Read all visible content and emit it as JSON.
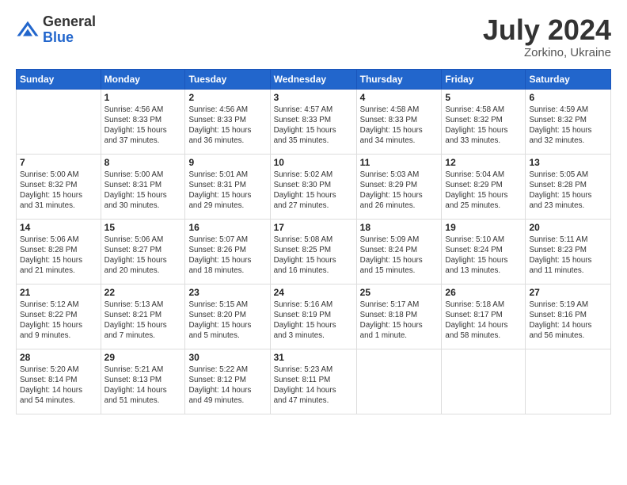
{
  "logo": {
    "general": "General",
    "blue": "Blue"
  },
  "title": {
    "month_year": "July 2024",
    "location": "Zorkino, Ukraine"
  },
  "headers": [
    "Sunday",
    "Monday",
    "Tuesday",
    "Wednesday",
    "Thursday",
    "Friday",
    "Saturday"
  ],
  "weeks": [
    [
      {
        "day": "",
        "info": ""
      },
      {
        "day": "1",
        "info": "Sunrise: 4:56 AM\nSunset: 8:33 PM\nDaylight: 15 hours\nand 37 minutes."
      },
      {
        "day": "2",
        "info": "Sunrise: 4:56 AM\nSunset: 8:33 PM\nDaylight: 15 hours\nand 36 minutes."
      },
      {
        "day": "3",
        "info": "Sunrise: 4:57 AM\nSunset: 8:33 PM\nDaylight: 15 hours\nand 35 minutes."
      },
      {
        "day": "4",
        "info": "Sunrise: 4:58 AM\nSunset: 8:33 PM\nDaylight: 15 hours\nand 34 minutes."
      },
      {
        "day": "5",
        "info": "Sunrise: 4:58 AM\nSunset: 8:32 PM\nDaylight: 15 hours\nand 33 minutes."
      },
      {
        "day": "6",
        "info": "Sunrise: 4:59 AM\nSunset: 8:32 PM\nDaylight: 15 hours\nand 32 minutes."
      }
    ],
    [
      {
        "day": "7",
        "info": "Sunrise: 5:00 AM\nSunset: 8:32 PM\nDaylight: 15 hours\nand 31 minutes."
      },
      {
        "day": "8",
        "info": "Sunrise: 5:00 AM\nSunset: 8:31 PM\nDaylight: 15 hours\nand 30 minutes."
      },
      {
        "day": "9",
        "info": "Sunrise: 5:01 AM\nSunset: 8:31 PM\nDaylight: 15 hours\nand 29 minutes."
      },
      {
        "day": "10",
        "info": "Sunrise: 5:02 AM\nSunset: 8:30 PM\nDaylight: 15 hours\nand 27 minutes."
      },
      {
        "day": "11",
        "info": "Sunrise: 5:03 AM\nSunset: 8:29 PM\nDaylight: 15 hours\nand 26 minutes."
      },
      {
        "day": "12",
        "info": "Sunrise: 5:04 AM\nSunset: 8:29 PM\nDaylight: 15 hours\nand 25 minutes."
      },
      {
        "day": "13",
        "info": "Sunrise: 5:05 AM\nSunset: 8:28 PM\nDaylight: 15 hours\nand 23 minutes."
      }
    ],
    [
      {
        "day": "14",
        "info": "Sunrise: 5:06 AM\nSunset: 8:28 PM\nDaylight: 15 hours\nand 21 minutes."
      },
      {
        "day": "15",
        "info": "Sunrise: 5:06 AM\nSunset: 8:27 PM\nDaylight: 15 hours\nand 20 minutes."
      },
      {
        "day": "16",
        "info": "Sunrise: 5:07 AM\nSunset: 8:26 PM\nDaylight: 15 hours\nand 18 minutes."
      },
      {
        "day": "17",
        "info": "Sunrise: 5:08 AM\nSunset: 8:25 PM\nDaylight: 15 hours\nand 16 minutes."
      },
      {
        "day": "18",
        "info": "Sunrise: 5:09 AM\nSunset: 8:24 PM\nDaylight: 15 hours\nand 15 minutes."
      },
      {
        "day": "19",
        "info": "Sunrise: 5:10 AM\nSunset: 8:24 PM\nDaylight: 15 hours\nand 13 minutes."
      },
      {
        "day": "20",
        "info": "Sunrise: 5:11 AM\nSunset: 8:23 PM\nDaylight: 15 hours\nand 11 minutes."
      }
    ],
    [
      {
        "day": "21",
        "info": "Sunrise: 5:12 AM\nSunset: 8:22 PM\nDaylight: 15 hours\nand 9 minutes."
      },
      {
        "day": "22",
        "info": "Sunrise: 5:13 AM\nSunset: 8:21 PM\nDaylight: 15 hours\nand 7 minutes."
      },
      {
        "day": "23",
        "info": "Sunrise: 5:15 AM\nSunset: 8:20 PM\nDaylight: 15 hours\nand 5 minutes."
      },
      {
        "day": "24",
        "info": "Sunrise: 5:16 AM\nSunset: 8:19 PM\nDaylight: 15 hours\nand 3 minutes."
      },
      {
        "day": "25",
        "info": "Sunrise: 5:17 AM\nSunset: 8:18 PM\nDaylight: 15 hours\nand 1 minute."
      },
      {
        "day": "26",
        "info": "Sunrise: 5:18 AM\nSunset: 8:17 PM\nDaylight: 14 hours\nand 58 minutes."
      },
      {
        "day": "27",
        "info": "Sunrise: 5:19 AM\nSunset: 8:16 PM\nDaylight: 14 hours\nand 56 minutes."
      }
    ],
    [
      {
        "day": "28",
        "info": "Sunrise: 5:20 AM\nSunset: 8:14 PM\nDaylight: 14 hours\nand 54 minutes."
      },
      {
        "day": "29",
        "info": "Sunrise: 5:21 AM\nSunset: 8:13 PM\nDaylight: 14 hours\nand 51 minutes."
      },
      {
        "day": "30",
        "info": "Sunrise: 5:22 AM\nSunset: 8:12 PM\nDaylight: 14 hours\nand 49 minutes."
      },
      {
        "day": "31",
        "info": "Sunrise: 5:23 AM\nSunset: 8:11 PM\nDaylight: 14 hours\nand 47 minutes."
      },
      {
        "day": "",
        "info": ""
      },
      {
        "day": "",
        "info": ""
      },
      {
        "day": "",
        "info": ""
      }
    ]
  ]
}
